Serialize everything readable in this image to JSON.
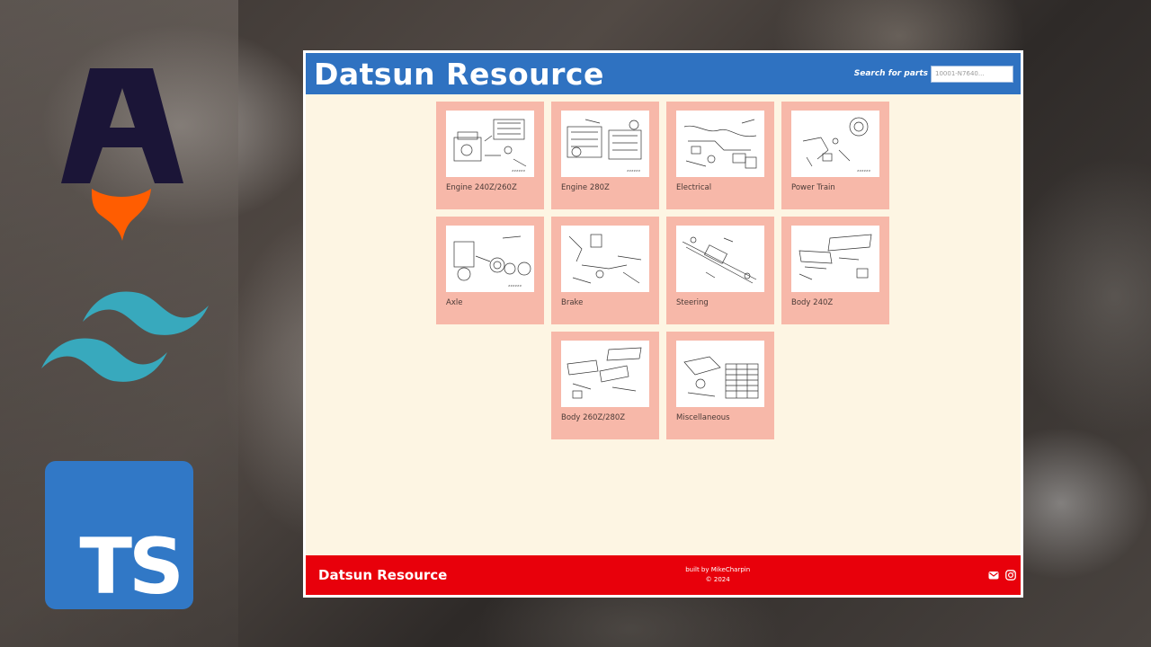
{
  "site": {
    "brand": "Datsun Resource",
    "search_label": "Search for parts",
    "search_placeholder": "10001-N7640..."
  },
  "categories": [
    {
      "label": "Engine 240Z/260Z",
      "icon": "engine-diagram"
    },
    {
      "label": "Engine 280Z",
      "icon": "engine-diagram"
    },
    {
      "label": "Electrical",
      "icon": "wiring-diagram"
    },
    {
      "label": "Power Train",
      "icon": "clutch-diagram"
    },
    {
      "label": "Axle",
      "icon": "axle-diagram"
    },
    {
      "label": "Brake",
      "icon": "brake-diagram"
    },
    {
      "label": "Steering",
      "icon": "steering-diagram"
    },
    {
      "label": "Body 240Z",
      "icon": "body-diagram"
    },
    {
      "label": "Body 260Z/280Z",
      "icon": "body-diagram"
    },
    {
      "label": "Miscellaneous",
      "icon": "misc-diagram"
    }
  ],
  "footer": {
    "brand": "Datsun Resource",
    "built_by": "built by MikeCharpin",
    "copyright": "© 2024",
    "icons": [
      "mail-icon",
      "instagram-icon"
    ]
  },
  "decor": {
    "logos": [
      "astro-logo",
      "tailwind-logo",
      "typescript-logo"
    ],
    "ts_text": "TS"
  },
  "colors": {
    "header": "#2f72c1",
    "page_bg": "#fdf5e3",
    "card_bg": "#f7b8a9",
    "footer": "#e8000b",
    "ts_blue": "#3178c6",
    "tailwind_teal": "#38a9bd",
    "astro_navy": "#1b1537",
    "astro_orange": "#ff5d01"
  }
}
